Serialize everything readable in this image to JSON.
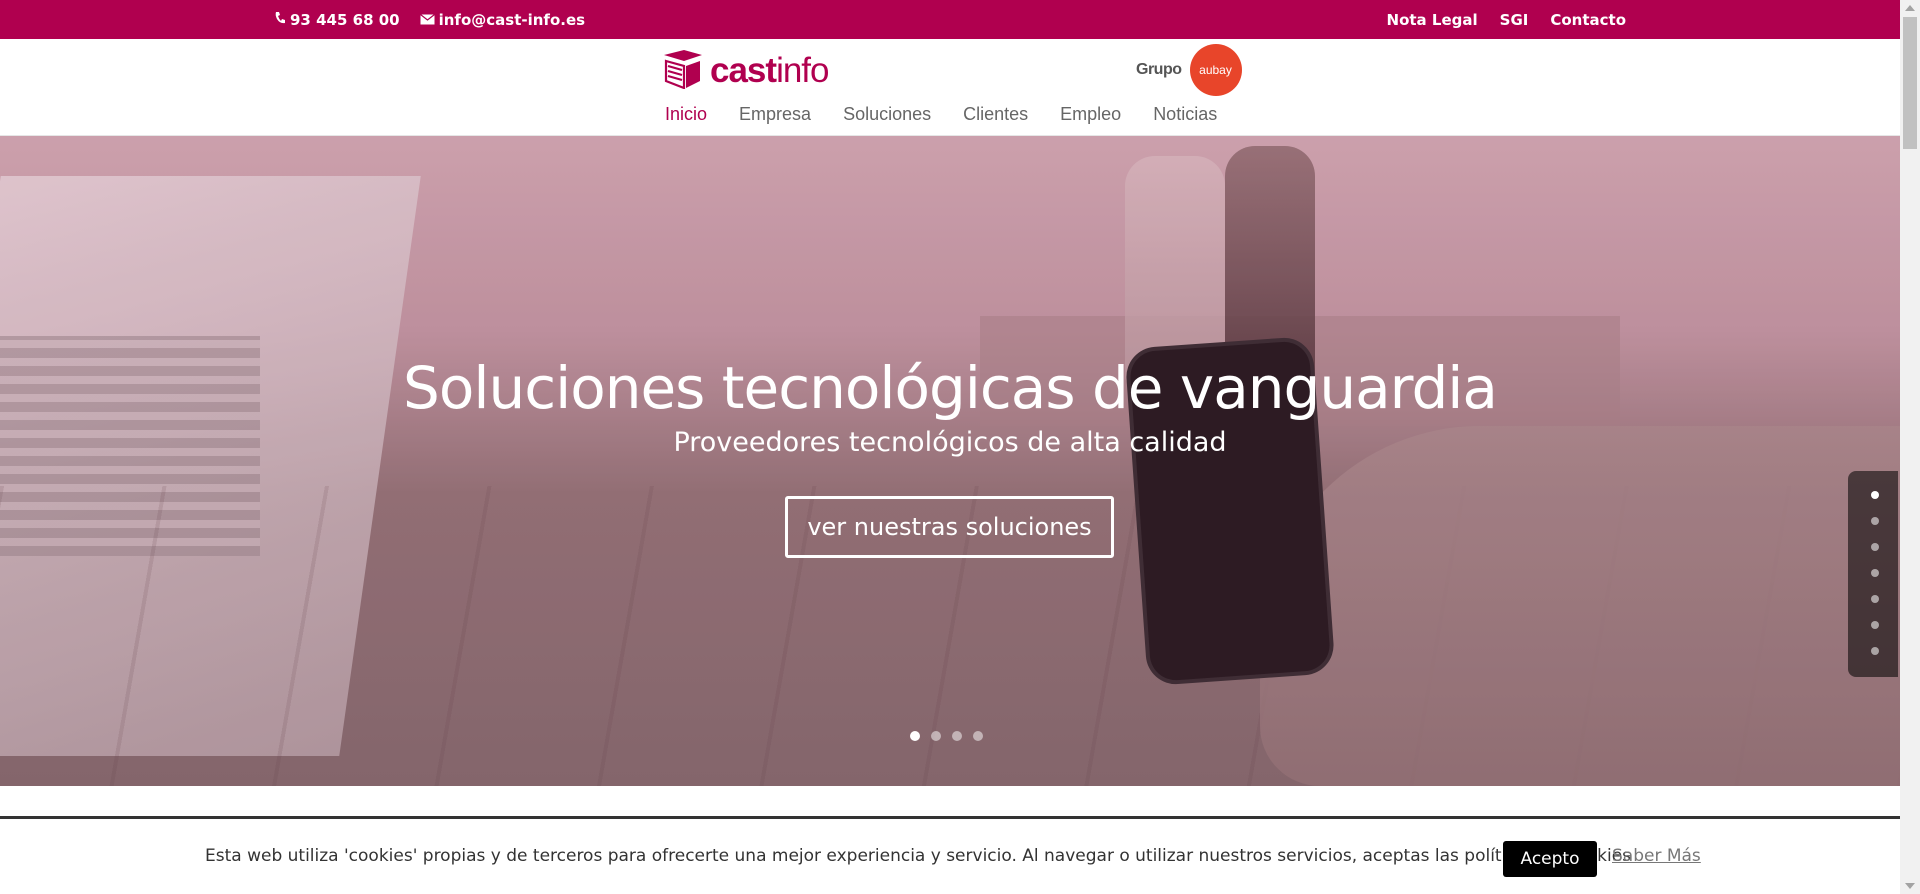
{
  "topbar": {
    "phone": "93 445 68 00",
    "email": "info@cast-info.es",
    "links": [
      "Nota Legal",
      "SGI",
      "Contacto"
    ],
    "phone_icon": "phone-icon",
    "email_icon": "envelope-icon"
  },
  "header": {
    "logo_bold": "cast",
    "logo_light": "info",
    "grupo_label": "Grupo",
    "grupo_logo_text": "aubay",
    "nav": [
      "Inicio",
      "Empresa",
      "Soluciones",
      "Clientes",
      "Empleo",
      "Noticias"
    ],
    "active_nav": "Inicio"
  },
  "hero": {
    "title": "Soluciones tecnológicas de vanguardia",
    "subtitle": "Proveedores tecnológicos de alta calidad",
    "button": "ver nuestras soluciones",
    "slide_count": 4,
    "active_slide": 1,
    "side_section_count": 7,
    "active_section": 1
  },
  "cookie": {
    "message": "Esta web utiliza 'cookies' propias y de terceros para ofrecerte una mejor experiencia y servicio. Al navegar o utilizar nuestros servicios, aceptas las políticas de cookies",
    "accept": "Acepto",
    "more": "Saber Más"
  },
  "colors": {
    "brand": "#b0004f",
    "grupo_logo": "#e8452a"
  }
}
